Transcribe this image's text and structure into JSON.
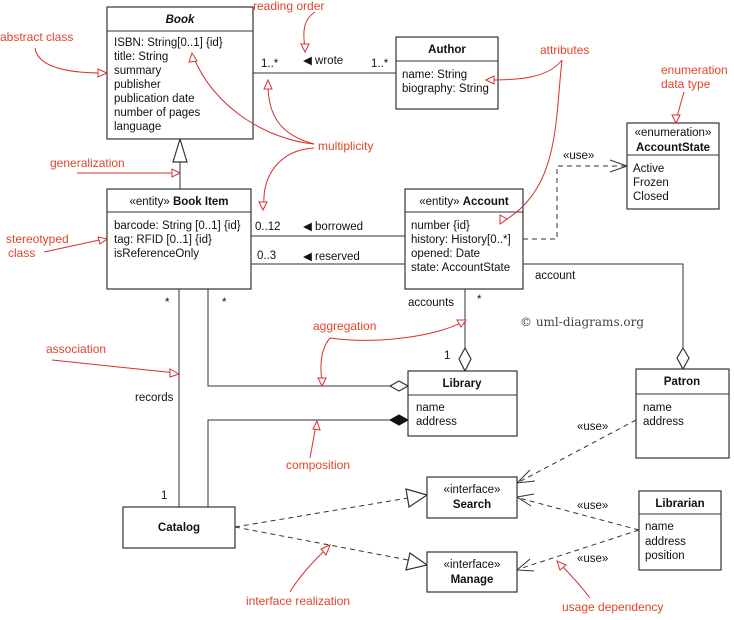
{
  "classes": {
    "book": {
      "name": "Book",
      "attributes": [
        "ISBN: String[0..1] {id}",
        "title: String",
        "summary",
        "publisher",
        "publication date",
        "number of pages",
        "language"
      ]
    },
    "author": {
      "name": "Author",
      "attributes": [
        "name: String",
        "biography: String"
      ]
    },
    "account_state": {
      "stereotype": "«enumeration»",
      "name": "AccountState",
      "literals": [
        "Active",
        "Frozen",
        "Closed"
      ]
    },
    "book_item": {
      "stereotype": "«entity»",
      "name": "Book Item",
      "attributes": [
        "barcode: String [0..1] {id}",
        "tag: RFID [0..1] {id}",
        "isReferenceOnly"
      ]
    },
    "account": {
      "stereotype": "«entity»",
      "name": "Account",
      "attributes": [
        "number {id}",
        "history: History[0..*]",
        "opened: Date",
        "state: AccountState"
      ]
    },
    "library": {
      "name": "Library",
      "attributes": [
        "name",
        "address"
      ]
    },
    "patron": {
      "name": "Patron",
      "attributes": [
        "name",
        "address"
      ]
    },
    "catalog": {
      "name": "Catalog"
    },
    "search": {
      "stereotype": "«interface»",
      "name": "Search"
    },
    "manage": {
      "stereotype": "«interface»",
      "name": "Manage"
    },
    "librarian": {
      "name": "Librarian",
      "attributes": [
        "name",
        "address",
        "position"
      ]
    }
  },
  "relations": {
    "wrote": {
      "label": "◀ wrote",
      "mult_book": "1..*",
      "mult_author": "1..*"
    },
    "borrowed": {
      "label": "◀ borrowed",
      "mult": "0..12"
    },
    "reserved": {
      "label": "◀ reserved",
      "mult": "0..3"
    },
    "account_patron": {
      "role": "account"
    },
    "account_library": {
      "role": "accounts",
      "mult_account": "*",
      "mult_library": "1"
    },
    "bookitem_library": {
      "mult": "*"
    },
    "catalog_records": {
      "role": "records",
      "mult_item": "*",
      "mult_catalog": "1"
    },
    "use_state": "«use»",
    "use_patron": "«use»",
    "use_librarian_search": "«use»",
    "use_librarian_manage": "«use»"
  },
  "annotations": {
    "abstract_class": "abstract class",
    "reading_order": "reading order",
    "attributes": "attributes",
    "enumeration": "enumeration",
    "data_type": "data type",
    "generalization": "generalization",
    "multiplicity": "multiplicity",
    "stereotyped": "stereotyped",
    "class": "class",
    "association": "association",
    "aggregation": "aggregation",
    "composition": "composition",
    "interface_realization": "interface realization",
    "usage_dependency": "usage dependency",
    "copyright": "© uml-diagrams.org"
  },
  "colors": {
    "annotation": "#e0452b",
    "annotation_arrow": "#d93030",
    "line": "#333333"
  }
}
